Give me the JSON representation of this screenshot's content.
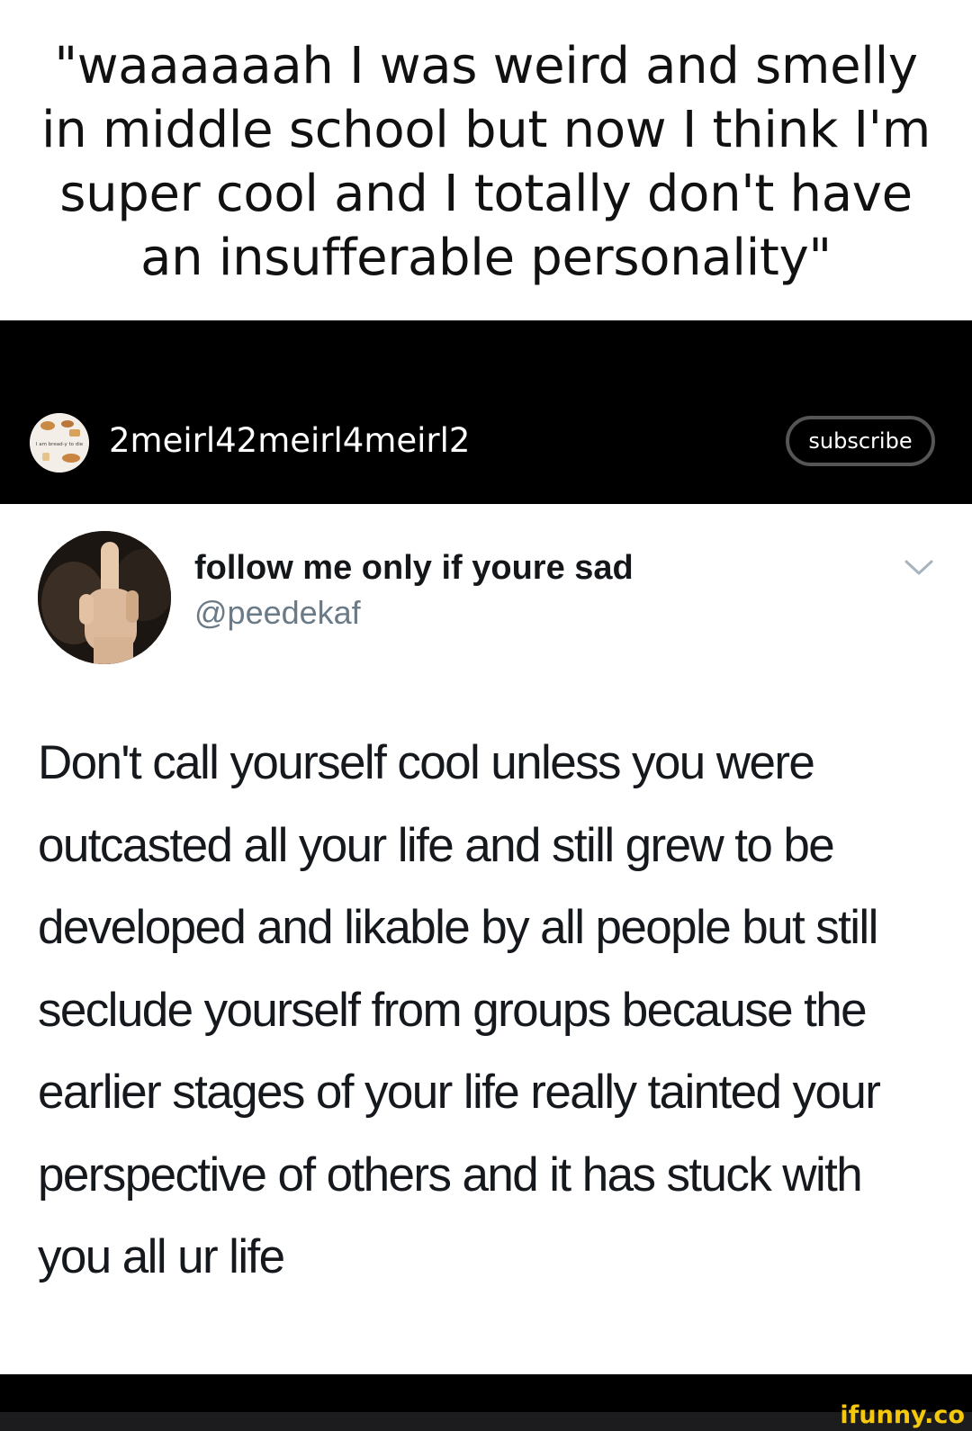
{
  "caption": {
    "text": "\"waaaaaah I was weird and smelly in middle school but now I think I'm super cool and I totally don't have an insufferable personality\""
  },
  "channel": {
    "name": "2meirl42meirl4meirl2",
    "avatar_text": "I am bread-y to die",
    "subscribe_label": "subscribe"
  },
  "tweet": {
    "display_name": "follow me only if youre sad",
    "handle": "@peedekaf",
    "body": "Don't call yourself cool unless you were outcasted all your life and still grew to be developed and likable by all people but still seclude yourself from groups because the earlier stages of your life really tainted your perspective of others and it has stuck with you all ur life",
    "menu_icon": "chevron-down-icon"
  },
  "watermark": {
    "text": "ifunny.co",
    "color": "#f6c80c"
  },
  "colors": {
    "channel_bar": "#000000",
    "subscribe_border": "#555555",
    "handle": "#6b7a87"
  }
}
